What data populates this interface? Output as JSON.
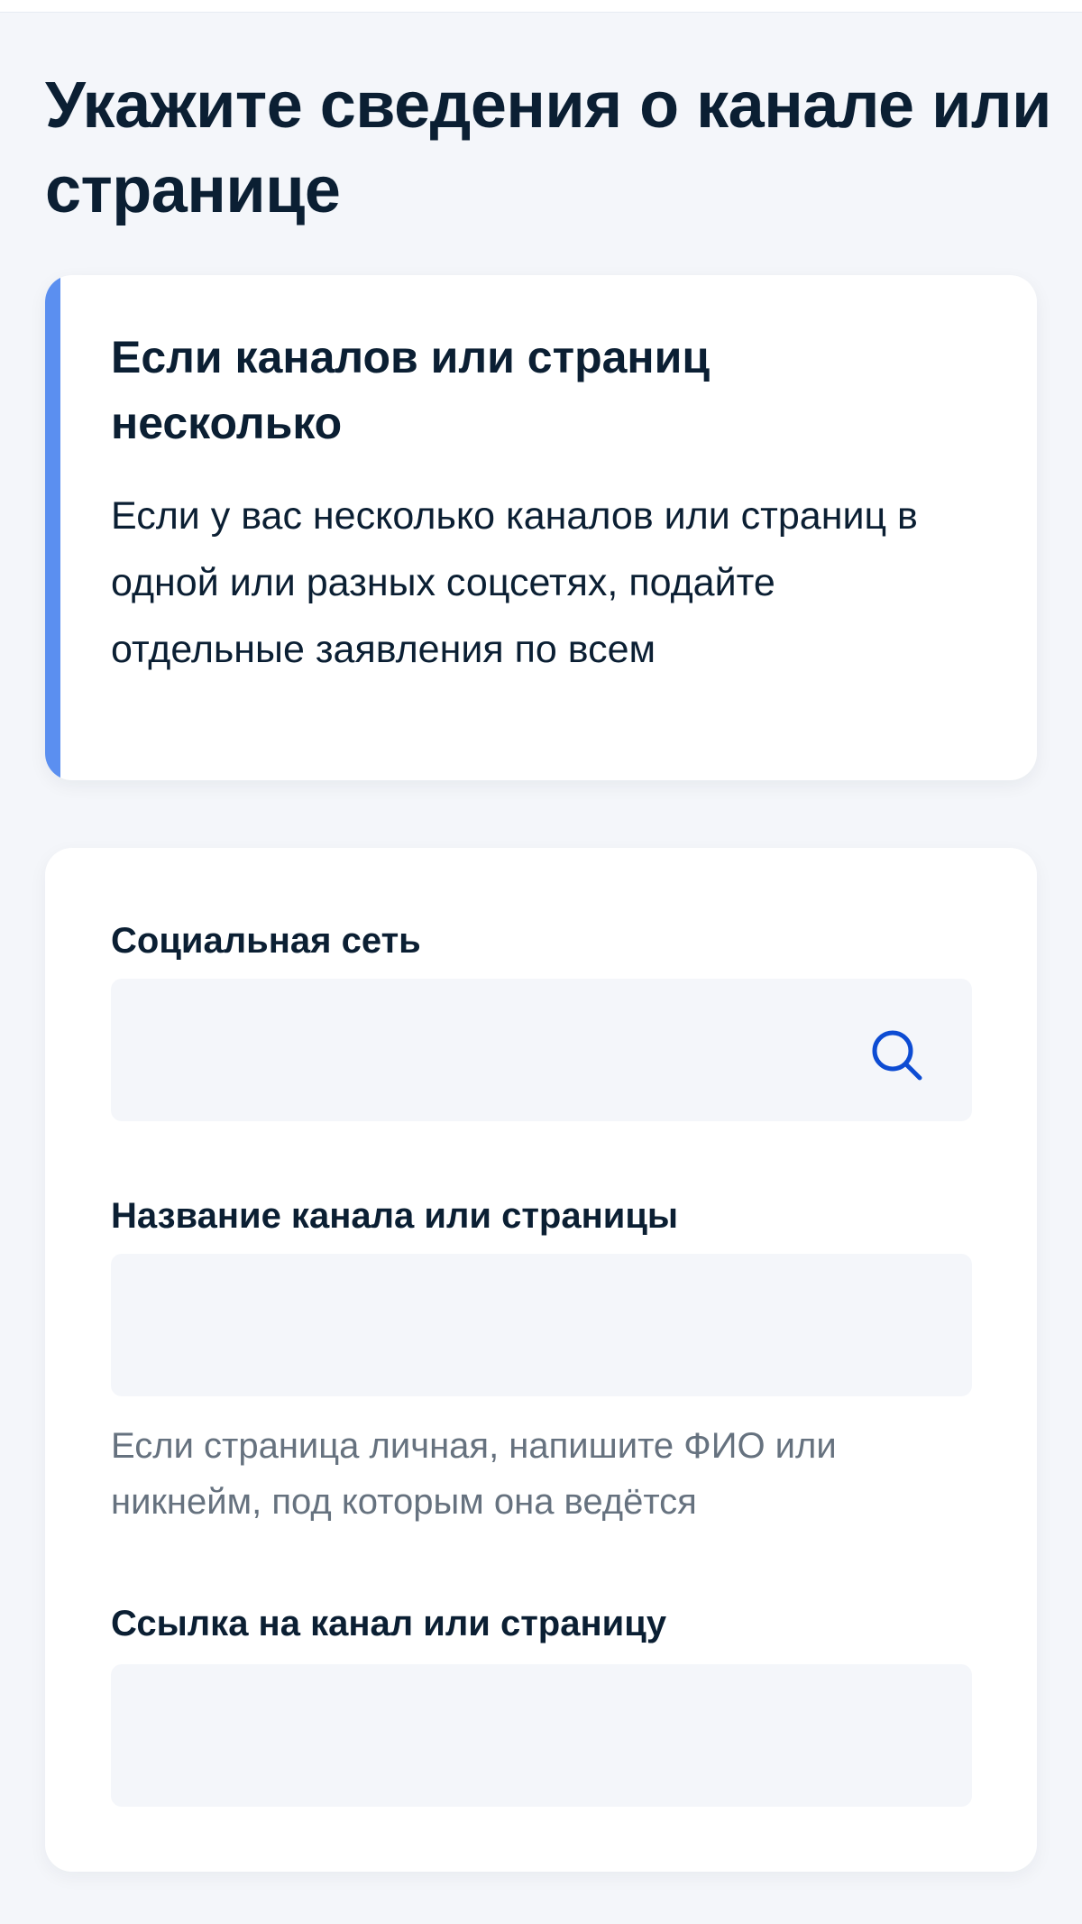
{
  "page": {
    "title": "Укажите сведения о канале или странице"
  },
  "info_card": {
    "title": "Если каналов или страниц несколько",
    "text": "Если у вас несколько каналов или страниц в одной или разных соцсетях, подайте отдельные заявления по всем",
    "accent_color": "#5b8ff0"
  },
  "form": {
    "social_network": {
      "label": "Социальная сеть",
      "value": "",
      "icon": "search-icon"
    },
    "channel_name": {
      "label": "Название канала или страницы",
      "value": "",
      "hint": "Если страница личная, напишите ФИО или никнейм, под которым она ведётся"
    },
    "channel_link": {
      "label": "Ссылка на канал или страницу",
      "value": ""
    }
  },
  "colors": {
    "background": "#f4f6fa",
    "text": "#0b1f33",
    "hint_text": "#66727f",
    "icon": "#0d4cd3"
  }
}
